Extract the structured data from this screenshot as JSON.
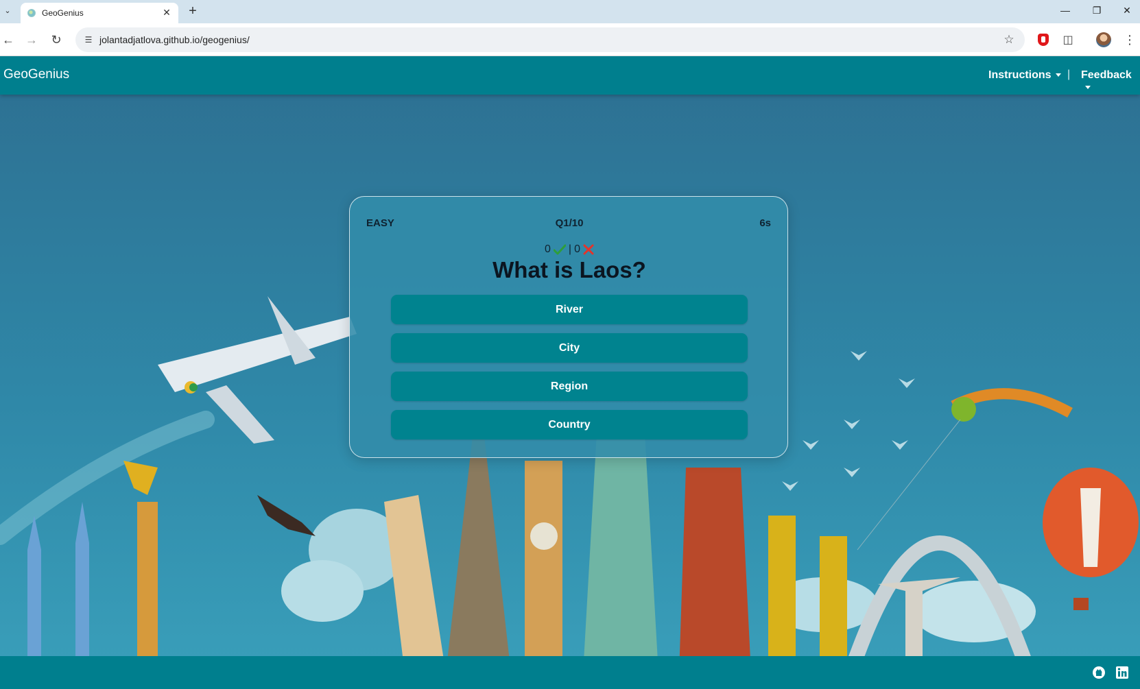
{
  "browser": {
    "tab_title": "GeoGenius",
    "url": "jolantadjatlova.github.io/geogenius/",
    "icons": [
      "tab-list-icon",
      "favicon-icon",
      "close-icon",
      "plus-icon",
      "minimize-icon",
      "restore-icon",
      "close-window-icon",
      "back-icon",
      "forward-icon",
      "reload-icon",
      "site-info-icon",
      "star-icon",
      "adblock-icon",
      "puzzle-icon",
      "profile-icon",
      "more-icon"
    ]
  },
  "navbar": {
    "brand": "GeoGenius",
    "instructions": "Instructions",
    "feedback": "Feedback",
    "separator": "|"
  },
  "quiz": {
    "level": "EASY",
    "progress": "Q1/10",
    "timer": "6s",
    "correct_count": "0",
    "score_separator": "|",
    "wrong_count": "0",
    "question": "What is Laos?",
    "answers": [
      "River",
      "City",
      "Region",
      "Country"
    ]
  },
  "footer": {
    "icons": [
      "github-icon",
      "linkedin-icon"
    ]
  },
  "colors": {
    "navbar": "#007f8e",
    "button": "#00838f",
    "correct": "#2e9e3a",
    "wrong": "#e5332a"
  }
}
